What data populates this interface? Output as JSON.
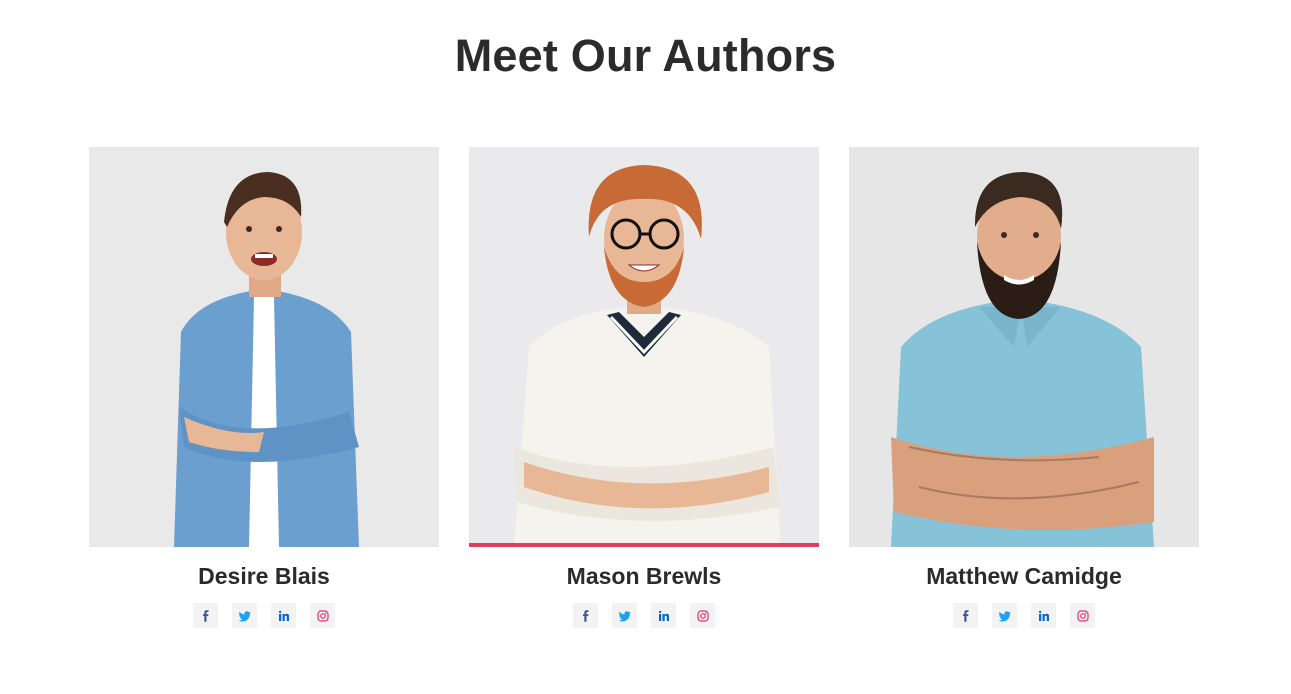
{
  "section": {
    "title": "Meet Our Authors"
  },
  "authors": [
    {
      "name": "Desire Blais",
      "photo_icon": "author-photo-desire-blais",
      "shirt_color": "#6a9fd0",
      "hair_color": "#4a2e1f",
      "highlighted": false
    },
    {
      "name": "Mason Brewls",
      "photo_icon": "author-photo-mason-brewls",
      "shirt_color": "#f5f3ee",
      "hair_color": "#c76a35",
      "highlighted": true
    },
    {
      "name": "Matthew Camidge",
      "photo_icon": "author-photo-matthew-camidge",
      "shirt_color": "#86c3d8",
      "hair_color": "#3a2a20",
      "highlighted": false
    }
  ],
  "social_icons": [
    "facebook-icon",
    "twitter-icon",
    "linkedin-icon",
    "instagram-icon"
  ],
  "colors": {
    "accent": "#e23e5c",
    "facebook": "#3b5998",
    "twitter": "#1da1f2",
    "linkedin": "#0a66c2",
    "instagram": "#e1306c",
    "skin": "#e8b796",
    "background_photo": "#ececec"
  }
}
